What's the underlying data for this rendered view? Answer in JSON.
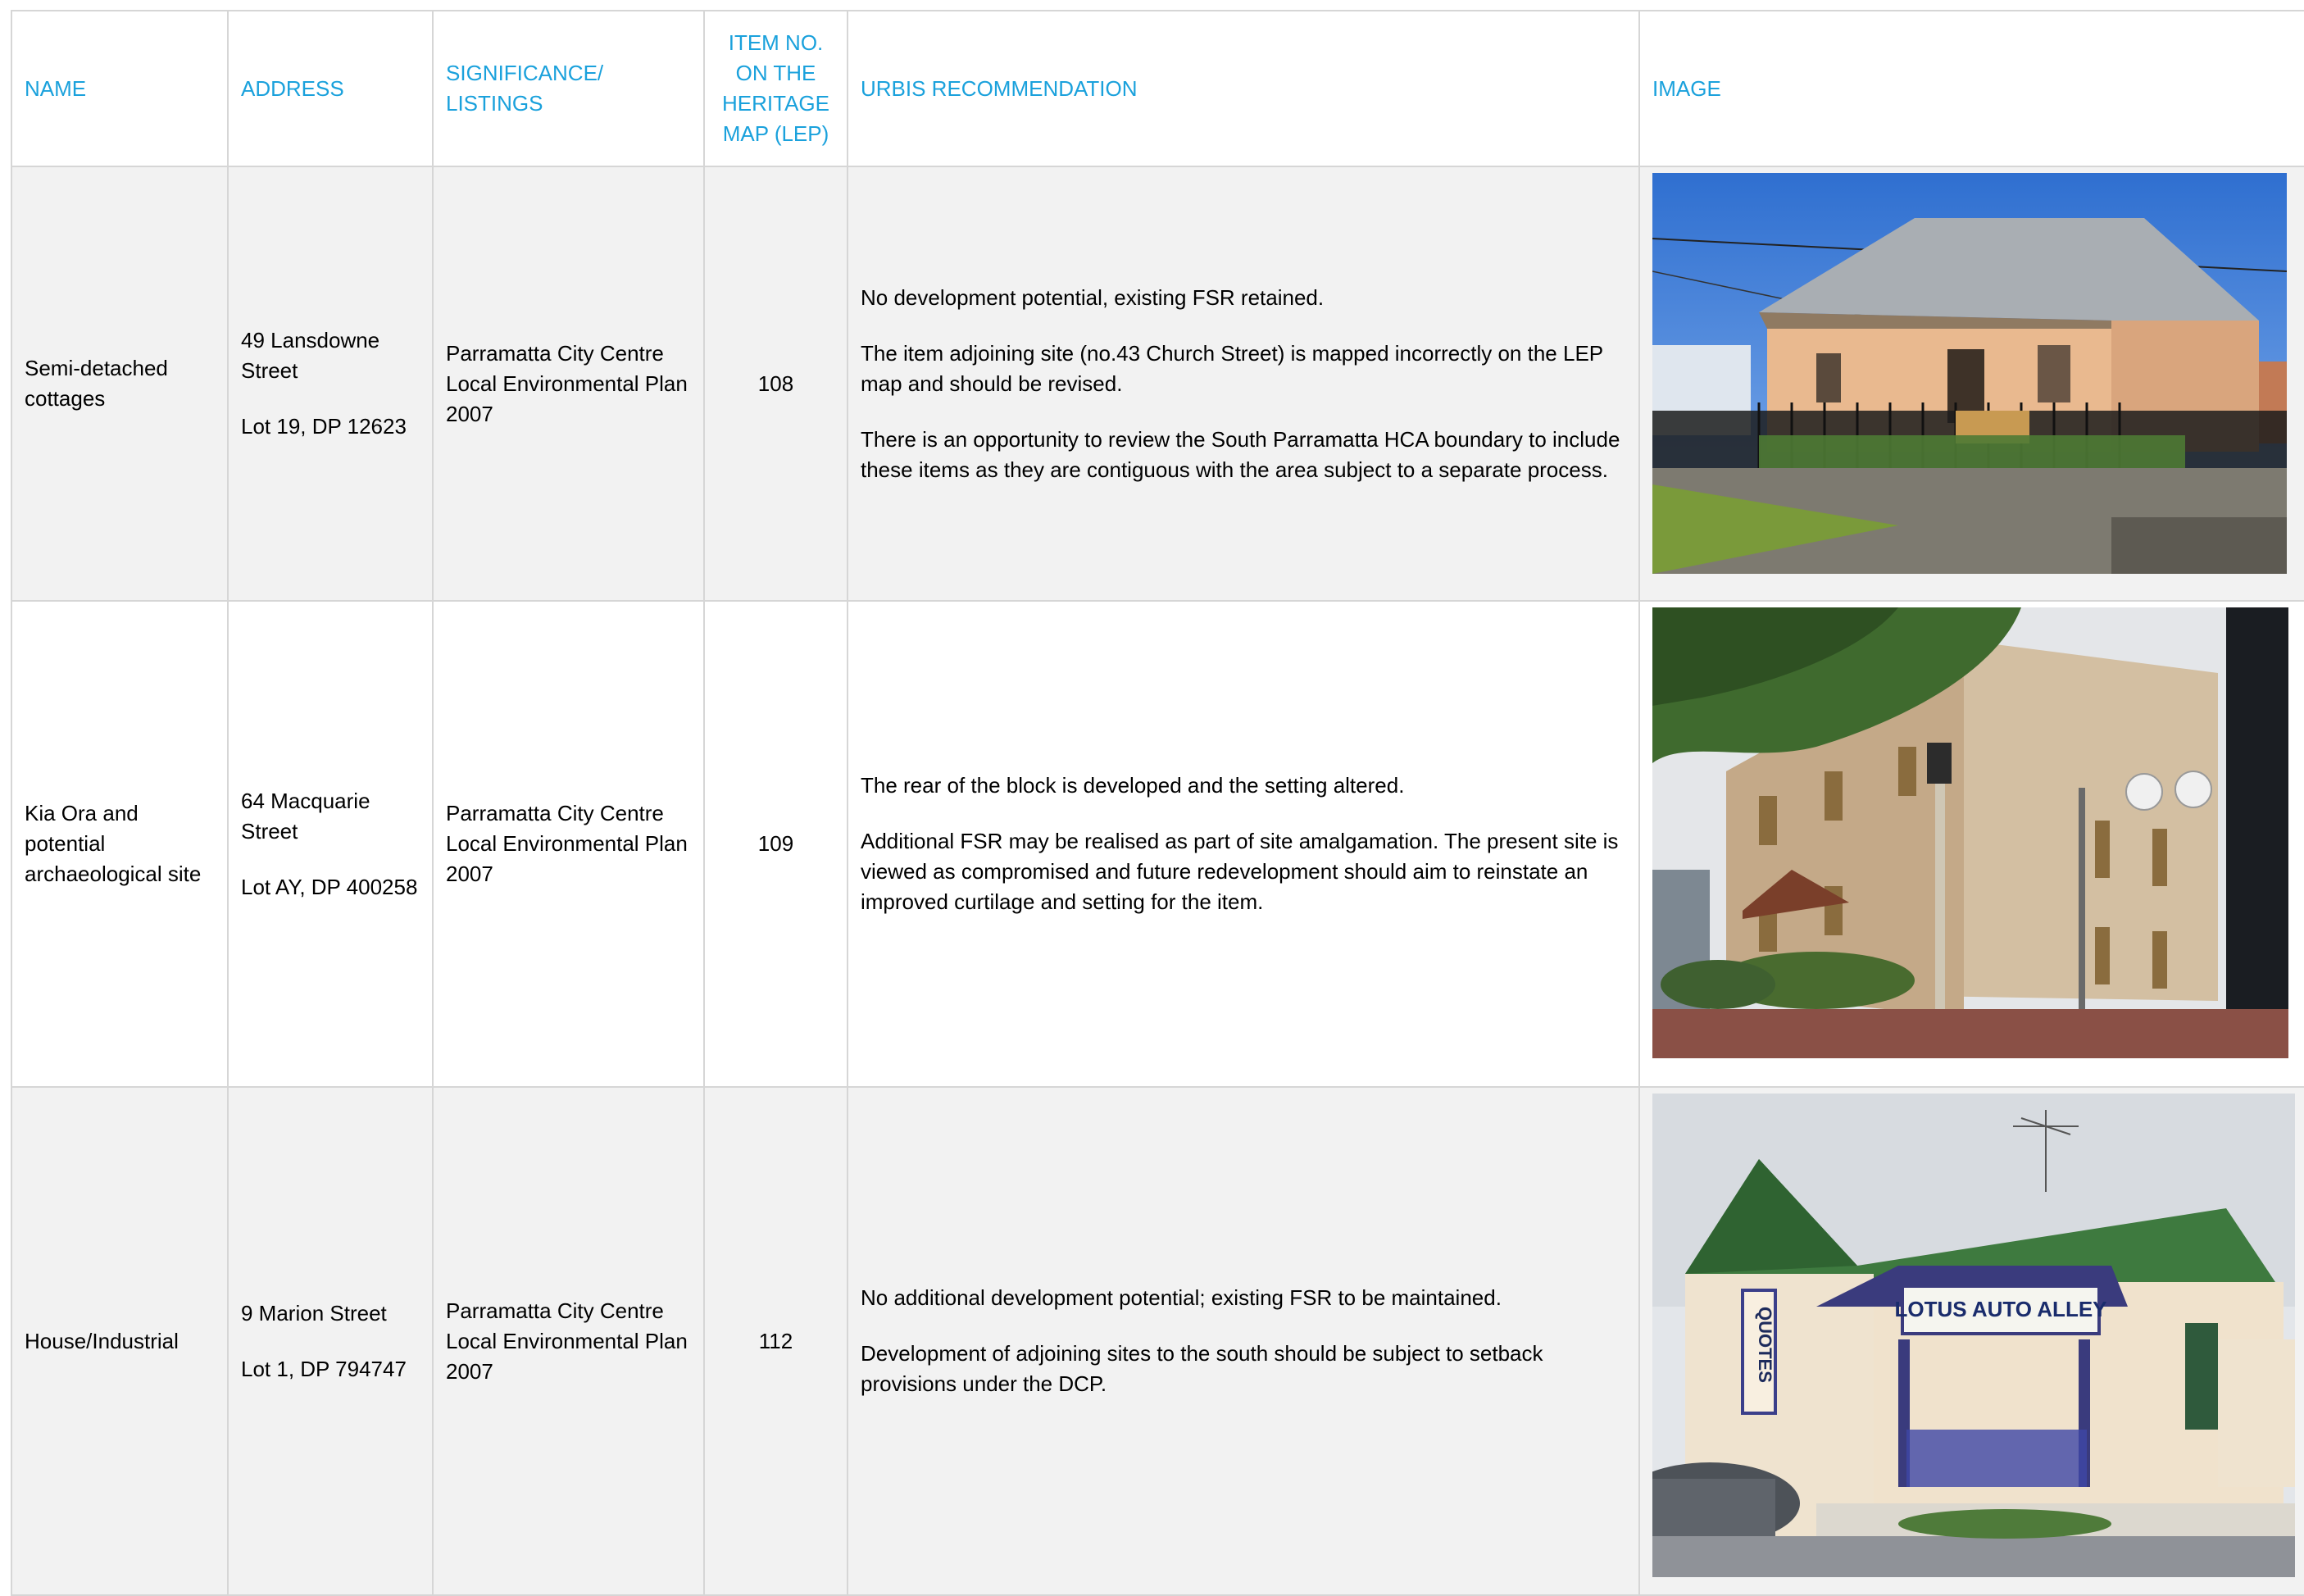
{
  "table": {
    "headers": {
      "name": "NAME",
      "address": "ADDRESS",
      "significance": "SIGNIFICANCE/ LISTINGS",
      "item_no": "ITEM NO. ON THE HERITAGE MAP (LEP)",
      "recommendation": "URBIS RECOMMENDATION",
      "image": "IMAGE"
    },
    "rows": [
      {
        "name": "Semi-detached cottages",
        "address_line1": "49 Lansdowne Street",
        "address_line2": "Lot 19, DP 12623",
        "significance": "Parramatta City Centre Local Environmental Plan 2007",
        "item_no": "108",
        "recommendation": [
          "No development potential, existing FSR retained.",
          "The item adjoining site (no.43 Church Street) is mapped incorrectly on the LEP map and should be revised.",
          "There is an opportunity to review the South Parramatta HCA boundary to include these items as they are contiguous with the area subject to a separate process."
        ],
        "image_subject": "photo of single-storey semi-detached cottages with verandah and iron fence"
      },
      {
        "name": "Kia Ora and potential archaeological site",
        "address_line1": "64 Macquarie Street",
        "address_line2": "Lot AY, DP 400258",
        "significance": "Parramatta City Centre Local Environmental Plan 2007",
        "item_no": "109",
        "recommendation": [
          "The rear of the block is developed and the setting altered.",
          "Additional FSR may be realised as part of site amalgamation. The present site is viewed as compromised and future redevelopment should aim to reinstate an improved curtilage and setting for the item."
        ],
        "image_subject": "photo of two-storey rendered building with shutters and street lamp"
      },
      {
        "name": "House/Industrial",
        "address_line1": "9 Marion Street",
        "address_line2": "Lot 1, DP 794747",
        "significance": "Parramatta City Centre Local Environmental Plan 2007",
        "item_no": "112",
        "recommendation": [
          "No additional development potential; existing FSR to be maintained.",
          "Development of adjoining sites to the south should be subject to setback provisions under the DCP."
        ],
        "image_subject": "photo of cream house with green roof used as an auto business",
        "image_signs": [
          "LOTUS AUTO ALLEY",
          "QUOTES"
        ]
      }
    ]
  },
  "colors": {
    "header_text": "#1aa1dc",
    "grid_line": "#d6d6d6",
    "row_shade": "#f2f2f2"
  }
}
